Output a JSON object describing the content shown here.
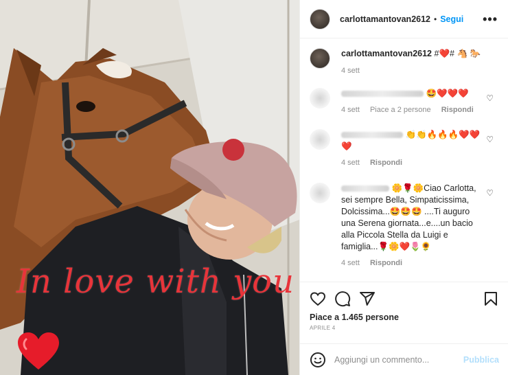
{
  "post": {
    "username": "carlottamantovan2612",
    "follow_label": "Segui",
    "more_label": "•••",
    "header_dot": "•",
    "overlay_text": "In love with you",
    "caption": {
      "username": "carlottamantovan2612",
      "text": "#❤️# 🐴 🐎",
      "time": "4 sett"
    },
    "comments": [
      {
        "text": "🤩❤️❤️❤️",
        "time": "4 sett",
        "likes": "Piace a 2 persone",
        "reply": "Rispondi"
      },
      {
        "text": "👏👏🔥🔥🔥❤️❤️❤️",
        "time": "4 sett",
        "reply": "Rispondi"
      },
      {
        "text": "🌼🌹🌼Ciao Carlotta, sei sempre Bella, Simpaticissima, Dolcissima...🤩🤩🤩 ....Ti auguro una Serena giornata...e....un bacio alla Piccola Stella da Luigi e famiglia...🌹🌼❤️🌷🌻",
        "time": "4 sett",
        "reply": "Rispondi"
      }
    ],
    "likes_text": "Piace a 1.465 persone",
    "date": "APRILE 4",
    "add_comment_placeholder": "Aggiungi un commento...",
    "publish_label": "Pubblica"
  },
  "icons": [
    "heart-icon",
    "comment-icon",
    "share-icon",
    "bookmark-icon",
    "emoji-icon",
    "more-icon"
  ],
  "colors": {
    "link": "#0095f6",
    "overlay_text": "#e8343a",
    "muted": "#8e8e8e",
    "publish_disabled": "#b2dffc"
  }
}
